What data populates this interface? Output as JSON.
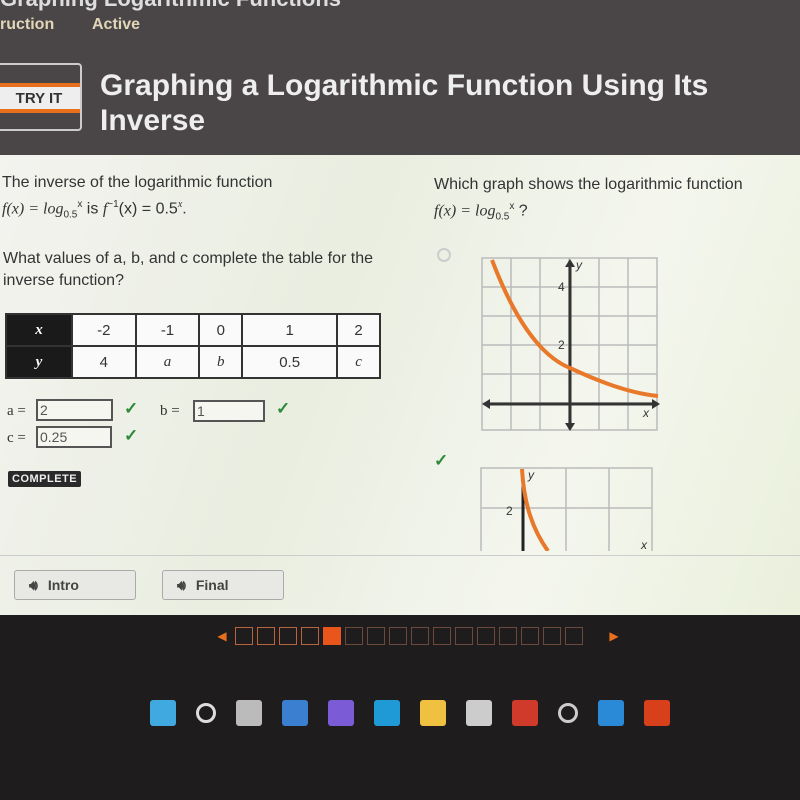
{
  "header": {
    "course_title": "Graphing Logarithmic Functions",
    "tabs": [
      "ruction",
      "Active"
    ],
    "badge": "TRY IT",
    "title": "Graphing a Logarithmic Function Using Its Inverse"
  },
  "left": {
    "intro_line1": "The inverse of the logarithmic function",
    "intro_f": "f(x) = log",
    "intro_base": "0.5",
    "intro_x": "x",
    "intro_is": " is ",
    "intro_inv": "f",
    "intro_inv_sup": "−1",
    "intro_inv_rest": "(x) = 0.5",
    "intro_inv_exp": "x",
    "intro_end": ".",
    "question": "What values of a, b, and c complete the table for the inverse function?",
    "table": {
      "row_x_label": "x",
      "row_y_label": "y",
      "x": [
        "-2",
        "-1",
        "0",
        "1",
        "2"
      ],
      "y": [
        "4",
        "a",
        "b",
        "0.5",
        "c"
      ]
    },
    "answers": [
      {
        "label": "a =",
        "value": "2",
        "correct": true
      },
      {
        "label": "b =",
        "value": "1",
        "correct": true
      },
      {
        "label": "c =",
        "value": "0.25",
        "correct": true
      }
    ],
    "check": "✓",
    "status": "COMPLETE"
  },
  "right": {
    "question_line1": "Which graph shows the logarithmic function",
    "question_f": "f(x) = log",
    "question_base": "0.5",
    "question_x": "x",
    "question_end": " ?",
    "graph1": {
      "selected": false,
      "y_labels": [
        "4",
        "2"
      ],
      "x_axis": "x",
      "y_axis": "y"
    },
    "graph2": {
      "selected": true,
      "y_labels": [
        "2"
      ],
      "x_axis": "x",
      "y_axis": "y"
    },
    "check": "✓"
  },
  "buttons": {
    "intro": "Intro",
    "final": "Final"
  },
  "pager": {
    "total": 16,
    "current": 5,
    "prev": "◀",
    "next": "▶"
  },
  "taskbar": {
    "icons": [
      "windows-start-icon",
      "search-icon",
      "task-view-icon",
      "widgets-icon",
      "teams-chat-icon",
      "edge-icon",
      "file-explorer-icon",
      "store-icon",
      "mcafee-icon",
      "settings-icon",
      "mail-icon",
      "office-icon"
    ]
  },
  "colors": {
    "accent": "#e8701c",
    "curve": "#e8782a",
    "correct": "#2d8a3a",
    "header_bg": "#4a4546"
  }
}
